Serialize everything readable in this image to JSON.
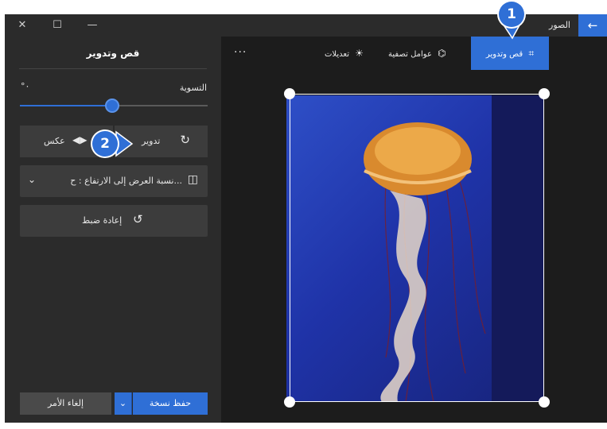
{
  "titlebar": {
    "app_title": "الصور",
    "back_icon": "arrow-left-icon",
    "close_glyph": "✕",
    "maximize_glyph": "☐",
    "minimize_glyph": "—"
  },
  "toolbar": {
    "more": "...",
    "adjustments_label": "تعديلات",
    "filters_label": "عوامل تصفية",
    "crop_rotate_label": "قص وتدوير"
  },
  "panel": {
    "title": "قص وتدوير",
    "straighten_label": "التسوية",
    "straighten_value": "°٠",
    "straighten_fraction": 0.5,
    "rotate_label": "تدوير",
    "flip_label": "عكس",
    "aspect_label": "نسبة العرض إلى الارتفاع : ح...",
    "reset_label": "إعادة ضبط",
    "save_label": "حفظ نسخة",
    "cancel_label": "إلغاء الأمر"
  },
  "callouts": {
    "one": "1",
    "two": "2"
  },
  "colors": {
    "accent": "#2f6fd6",
    "panel_bg": "#2b2b2b",
    "canvas_bg": "#1c1c1c"
  }
}
